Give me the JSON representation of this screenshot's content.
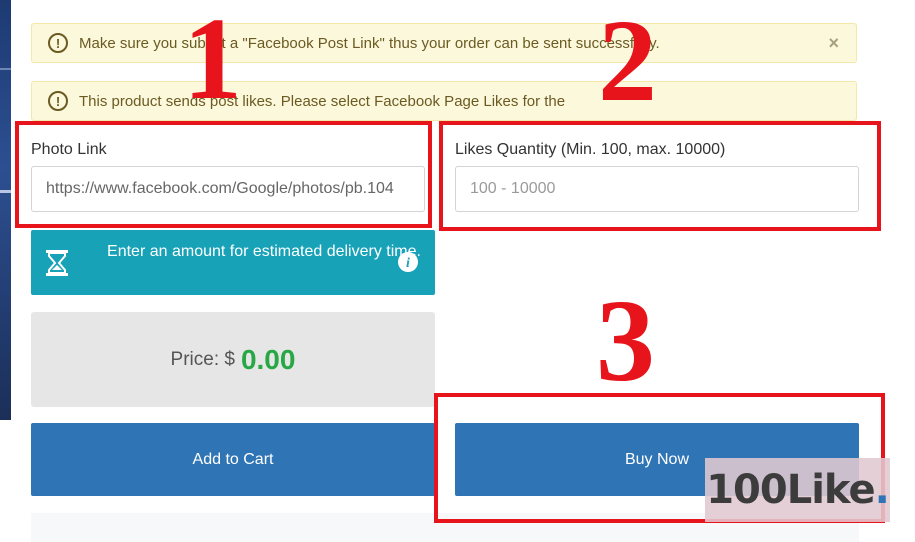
{
  "alerts": {
    "alert_1_text": "Make sure you submit a \"Facebook Post Link\" thus your order can be sent successfully.",
    "alert_1_close": "×",
    "alert_2_text": "This product sends post likes. Please select Facebook Page Likes for the",
    "icon_glyph": "!"
  },
  "form": {
    "photo_link_label": "Photo Link",
    "photo_link_value": "https://www.facebook.com/Google/photos/pb.104",
    "likes_label": "Likes Quantity (Min. 100, max. 10000)",
    "likes_placeholder": "100 - 10000"
  },
  "delivery": {
    "text": "Enter an amount for estimated delivery time.",
    "info_glyph": "i"
  },
  "price": {
    "label": "Price: $",
    "amount": "0.00"
  },
  "buttons": {
    "add_to_cart": "Add to Cart",
    "buy_now": "Buy Now"
  },
  "annotations": {
    "step_1": "1",
    "step_2": "2",
    "step_3": "3",
    "box_color": "#e8141c"
  },
  "watermark": {
    "text": "100Like",
    "dot": "."
  },
  "colors": {
    "alert_bg": "#fcf8dc",
    "info_bg": "#17a2b8",
    "button_bg": "#2f75b5",
    "price_green": "#28a745"
  }
}
